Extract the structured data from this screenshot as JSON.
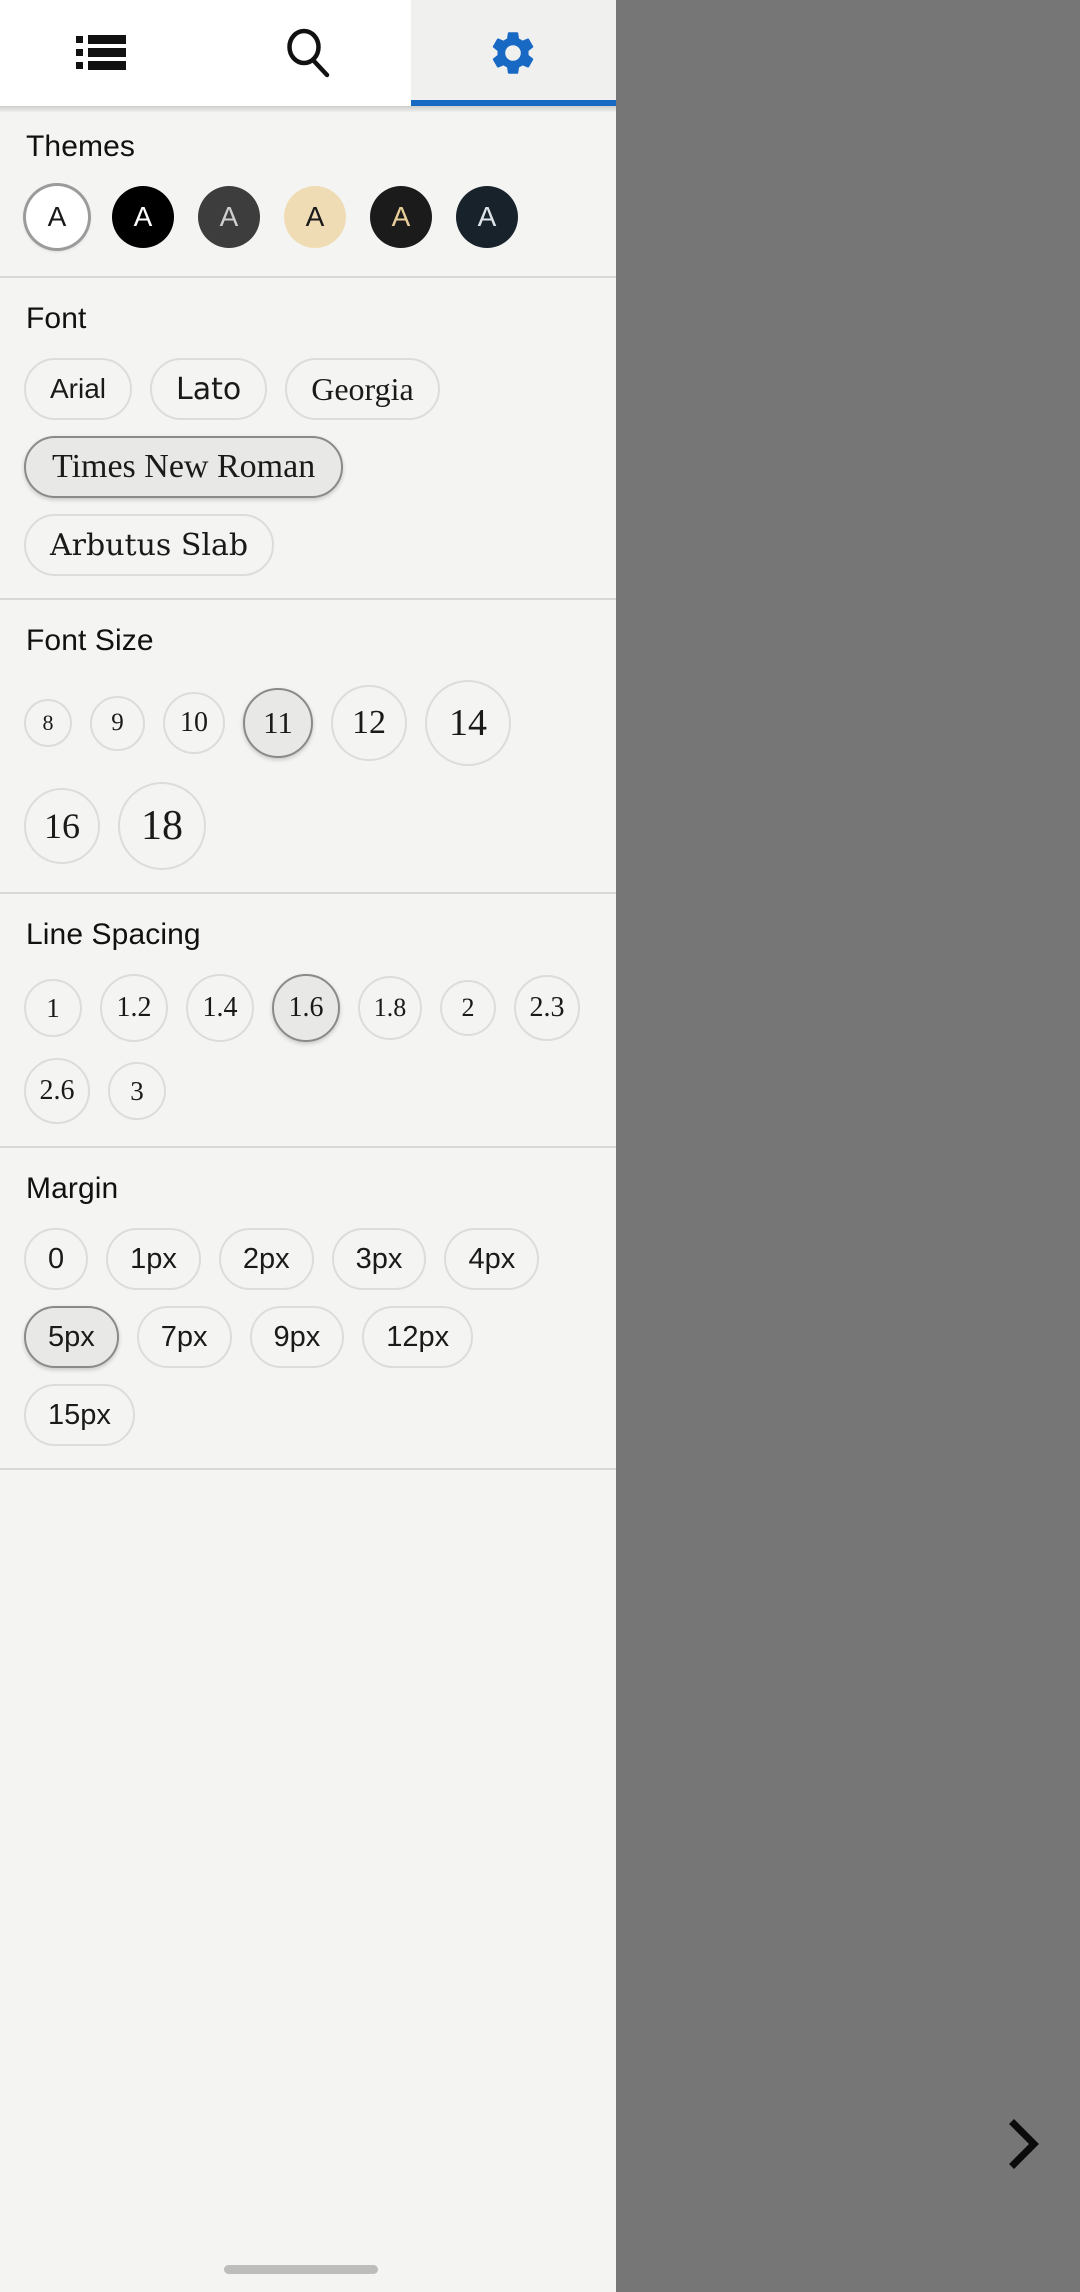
{
  "tabbar": {
    "tabs": [
      {
        "id": "contents",
        "icon": "list-icon",
        "label": "Contents",
        "active": false
      },
      {
        "id": "search",
        "icon": "search-icon",
        "label": "Search",
        "active": false
      },
      {
        "id": "settings",
        "icon": "gear-icon",
        "label": "Settings",
        "active": true
      }
    ],
    "accent_color": "#1769c4"
  },
  "sections": {
    "themes": {
      "title": "Themes",
      "items": [
        {
          "letter": "A",
          "bg": "#ffffff",
          "fg": "#1a1a1a",
          "selected": true,
          "name": "theme-light"
        },
        {
          "letter": "A",
          "bg": "#000000",
          "fg": "#ffffff",
          "selected": false,
          "name": "theme-black"
        },
        {
          "letter": "A",
          "bg": "#3d3d3d",
          "fg": "#cfcfcf",
          "selected": false,
          "name": "theme-dark-gray"
        },
        {
          "letter": "A",
          "bg": "#f0dcb4",
          "fg": "#1a1a1a",
          "selected": false,
          "name": "theme-sepia"
        },
        {
          "letter": "A",
          "bg": "#1b1b1b",
          "fg": "#e8cf9a",
          "selected": false,
          "name": "theme-dark-sepia"
        },
        {
          "letter": "A",
          "bg": "#18222b",
          "fg": "#dfe4e8",
          "selected": false,
          "name": "theme-navy"
        }
      ]
    },
    "font": {
      "title": "Font",
      "selected": "Times New Roman",
      "items": [
        {
          "label": "Arial",
          "class": "f-arial",
          "selected": false
        },
        {
          "label": "Lato",
          "class": "f-lato",
          "selected": false
        },
        {
          "label": "Georgia",
          "class": "f-georgia",
          "selected": false
        },
        {
          "label": "Times New Roman",
          "class": "f-times",
          "selected": true
        },
        {
          "label": "Arbutus Slab",
          "class": "f-arbutus",
          "selected": false
        }
      ]
    },
    "font_size": {
      "title": "Font Size",
      "selected": "11",
      "items": [
        {
          "label": "8",
          "selected": false,
          "d": 48,
          "fs": 22
        },
        {
          "label": "9",
          "selected": false,
          "d": 55,
          "fs": 25
        },
        {
          "label": "10",
          "selected": false,
          "d": 62,
          "fs": 28
        },
        {
          "label": "11",
          "selected": true,
          "d": 70,
          "fs": 31
        },
        {
          "label": "12",
          "selected": false,
          "d": 76,
          "fs": 34
        },
        {
          "label": "14",
          "selected": false,
          "d": 86,
          "fs": 38
        },
        {
          "label": "16",
          "selected": false,
          "d": 76,
          "fs": 36
        },
        {
          "label": "18",
          "selected": false,
          "d": 88,
          "fs": 42
        }
      ]
    },
    "line_spacing": {
      "title": "Line Spacing",
      "selected": "1.6",
      "items": [
        {
          "label": "1",
          "selected": false,
          "d": 58,
          "fs": 27
        },
        {
          "label": "1.2",
          "selected": false,
          "d": 68,
          "fs": 28
        },
        {
          "label": "1.4",
          "selected": false,
          "d": 68,
          "fs": 28
        },
        {
          "label": "1.6",
          "selected": true,
          "d": 68,
          "fs": 28
        },
        {
          "label": "1.8",
          "selected": false,
          "d": 64,
          "fs": 26
        },
        {
          "label": "2",
          "selected": false,
          "d": 56,
          "fs": 26
        },
        {
          "label": "2.3",
          "selected": false,
          "d": 66,
          "fs": 28
        },
        {
          "label": "2.6",
          "selected": false,
          "d": 66,
          "fs": 28
        },
        {
          "label": "3",
          "selected": false,
          "d": 58,
          "fs": 27
        }
      ]
    },
    "margin": {
      "title": "Margin",
      "selected": "5px",
      "items": [
        {
          "label": "0",
          "selected": false
        },
        {
          "label": "1px",
          "selected": false
        },
        {
          "label": "2px",
          "selected": false
        },
        {
          "label": "3px",
          "selected": false
        },
        {
          "label": "4px",
          "selected": false
        },
        {
          "label": "5px",
          "selected": true
        },
        {
          "label": "7px",
          "selected": false
        },
        {
          "label": "9px",
          "selected": false
        },
        {
          "label": "12px",
          "selected": false
        },
        {
          "label": "15px",
          "selected": false
        }
      ]
    }
  },
  "overlay": {
    "next_chevron": "chevron-right-icon",
    "scrim_color": "#767676"
  }
}
